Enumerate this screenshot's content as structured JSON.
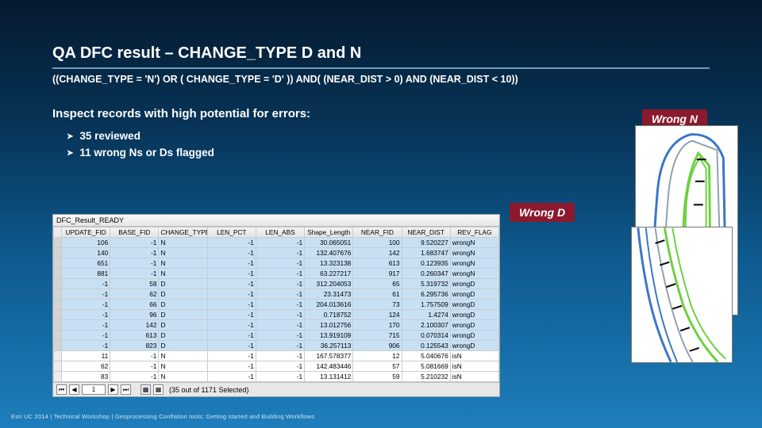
{
  "title": "QA DFC result – CHANGE_TYPE D and N",
  "query": "((CHANGE_TYPE = 'N') OR ( CHANGE_TYPE = 'D' )) AND( (NEAR_DIST > 0) AND (NEAR_DIST < 10))",
  "subhead": "Inspect records with high potential for errors:",
  "bullets": [
    "35 reviewed",
    "11 wrong Ns or Ds flagged"
  ],
  "tags": {
    "n": "Wrong N",
    "d": "Wrong D"
  },
  "table": {
    "title": "DFC_Result_READY",
    "headers": [
      "UPDATE_FID",
      "BASE_FID",
      "CHANGE_TYPE",
      "LEN_PCT",
      "LEN_ABS",
      "Shape_Length",
      "NEAR_FID",
      "NEAR_DIST",
      "REV_FLAG"
    ],
    "rows": [
      [
        "106",
        "-1",
        "N",
        "-1",
        "-1",
        "30.065051",
        "100",
        "9.520227",
        "wrongN"
      ],
      [
        "140",
        "-1",
        "N",
        "-1",
        "-1",
        "132.407676",
        "142",
        "1.683747",
        "wrongN"
      ],
      [
        "651",
        "-1",
        "N",
        "-1",
        "-1",
        "13.323138",
        "613",
        "0.123935",
        "wrongN"
      ],
      [
        "881",
        "-1",
        "N",
        "-1",
        "-1",
        "63.227217",
        "917",
        "0.260347",
        "wrongN"
      ],
      [
        "-1",
        "58",
        "D",
        "-1",
        "-1",
        "312.204053",
        "65",
        "5.319732",
        "wrongD"
      ],
      [
        "-1",
        "62",
        "D",
        "-1",
        "-1",
        "23.31473",
        "61",
        "6.295736",
        "wrongD"
      ],
      [
        "-1",
        "66",
        "D",
        "-1",
        "-1",
        "204.013616",
        "73",
        "1.757509",
        "wrongD"
      ],
      [
        "-1",
        "96",
        "D",
        "-1",
        "-1",
        "0.718752",
        "124",
        "1.4274",
        "wrongD"
      ],
      [
        "-1",
        "142",
        "D",
        "-1",
        "-1",
        "13.012756",
        "170",
        "2.100307",
        "wrongD"
      ],
      [
        "-1",
        "613",
        "D",
        "-1",
        "-1",
        "13.919109",
        "715",
        "0.070314",
        "wrongD"
      ],
      [
        "-1",
        "823",
        "D",
        "-1",
        "-1",
        "36.257113",
        "906",
        "0.125543",
        "wrongD"
      ],
      [
        "11",
        "-1",
        "N",
        "-1",
        "-1",
        "167.578377",
        "12",
        "5.040676",
        "isN"
      ],
      [
        "62",
        "-1",
        "N",
        "-1",
        "-1",
        "142.483446",
        "57",
        "5.081669",
        "isN"
      ],
      [
        "83",
        "-1",
        "N",
        "-1",
        "-1",
        "13.131412",
        "59",
        "5.210232",
        "isN"
      ]
    ],
    "footer_status": "(35 out of 1171 Selected)",
    "page_value": "1"
  },
  "footer": "Esri UC 2014 | Technical Workshop |  Geoprocessing Conflation tools: Getting started and Building Workflows"
}
